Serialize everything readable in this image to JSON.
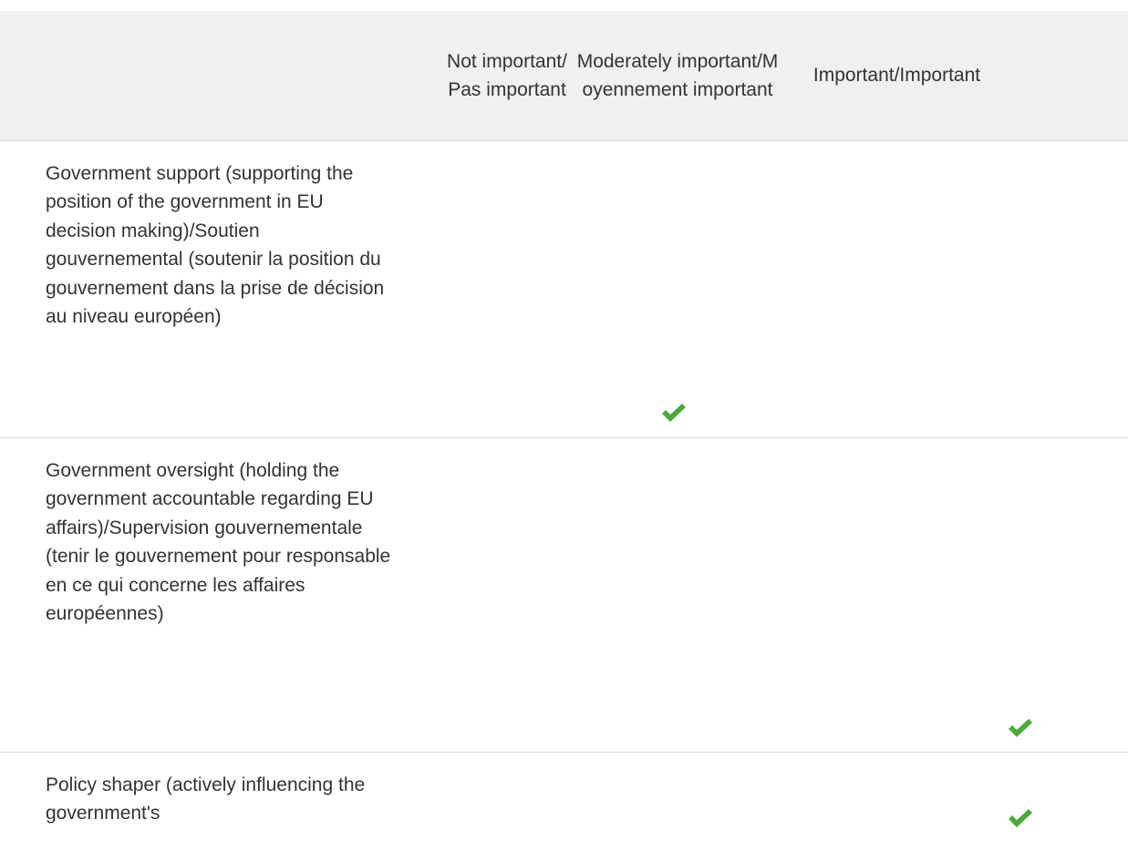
{
  "columns": {
    "blank": "",
    "not_important": "Not important/Pas important",
    "moderately_important": "Moderately important/Moyennement important",
    "important": "Important/Important"
  },
  "rows": [
    {
      "label": "Government support (supporting the position of the government in EU decision making)/Soutien gouvernemental (soutenir la position du gouvernement dans la prise de décision au niveau européen)",
      "selected": "Moderately important/Moyennement important"
    },
    {
      "label": "Government oversight (holding the government accountable regarding EU affairs)/Supervision gouvernementale (tenir le gouvernement pour responsable en ce qui concerne les affaires européennes)",
      "selected": "Important/Important"
    },
    {
      "label": "Policy shaper (actively influencing the government's",
      "selected": "Important/Important"
    }
  ],
  "icons": {
    "check": "check-icon",
    "check_color": "#4caa3c"
  }
}
